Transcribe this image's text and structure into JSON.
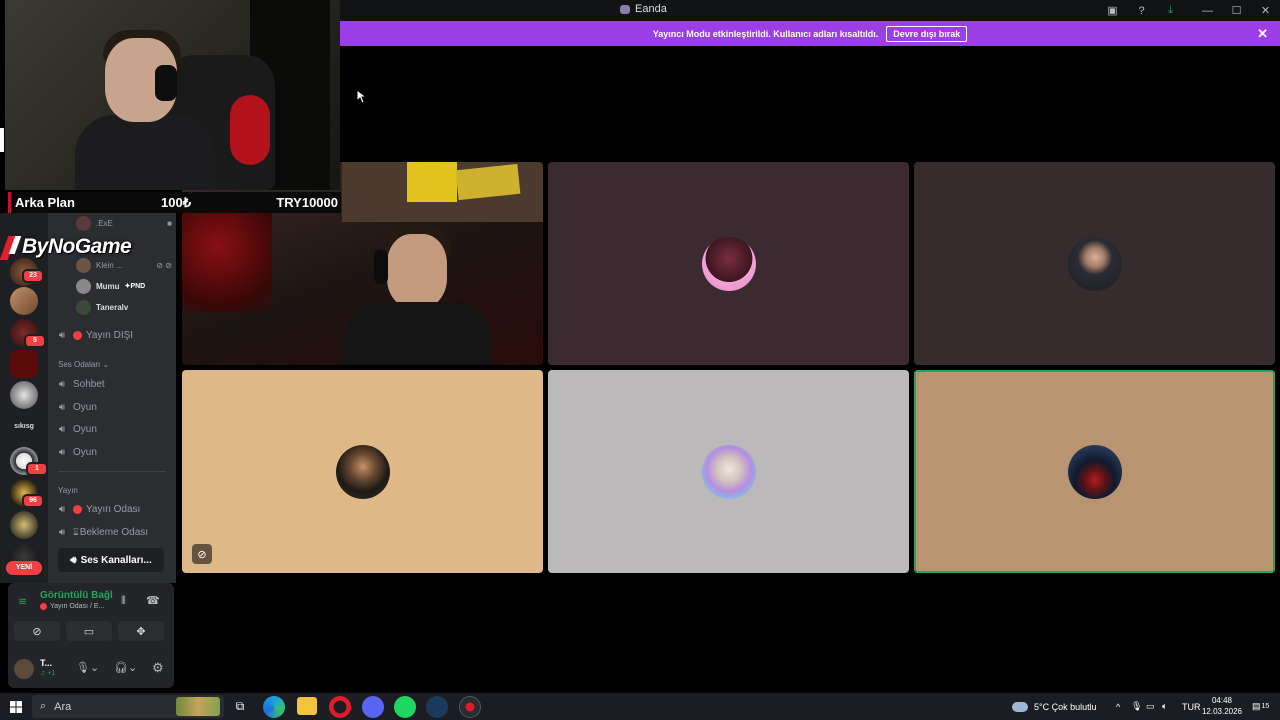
{
  "window": {
    "title": "Eanda"
  },
  "banner": {
    "message": "Yayıncı Modu etkinleştirildi. Kullanıcı adları kısaltıldı.",
    "button": "Devre dışı bırak"
  },
  "overlay": {
    "label": "Arka Plan",
    "amount": "100₺",
    "goal": "TRY10000",
    "brand": "ByNoGame"
  },
  "servers": {
    "badges": [
      "23",
      "5",
      "1",
      "96"
    ],
    "text_label": "sıkısg",
    "new_label": "YENİ"
  },
  "channels": {
    "top_member": ".ExE",
    "members": [
      {
        "name": "Klein ..."
      },
      {
        "name": "Mumu",
        "tag": "PND"
      },
      {
        "name": "Taneralv"
      }
    ],
    "stream_off": "Yayın DIŞI",
    "voice_category": "Ses Odaları",
    "voice_channels": [
      "Sohbet",
      "Oyun",
      "Oyun",
      "Oyun"
    ],
    "stream_category": "Yayın",
    "stream_channels": [
      "Yayın Odası",
      "Bekleme Odası"
    ],
    "more_button": "Ses Kanalları..."
  },
  "voice_panel": {
    "status": "Görüntülü Bağl",
    "location": "Yayın Odası / E...",
    "user_name": "T...",
    "user_status": "♫ +1"
  },
  "taskbar": {
    "search_placeholder": "Ara",
    "weather": "5°C  Çok bulutlu",
    "lang": "TUR",
    "time": "04:48",
    "date": "12.03.2026",
    "notif_count": "15"
  },
  "colors": {
    "banner": "#9b3ee8",
    "speaking": "#23a55a",
    "tile_2": "#3b2a2f",
    "tile_3": "#362c2e",
    "tile_4": "#deb887",
    "tile_5": "#bcb9bb",
    "tile_6": "#b89470"
  }
}
